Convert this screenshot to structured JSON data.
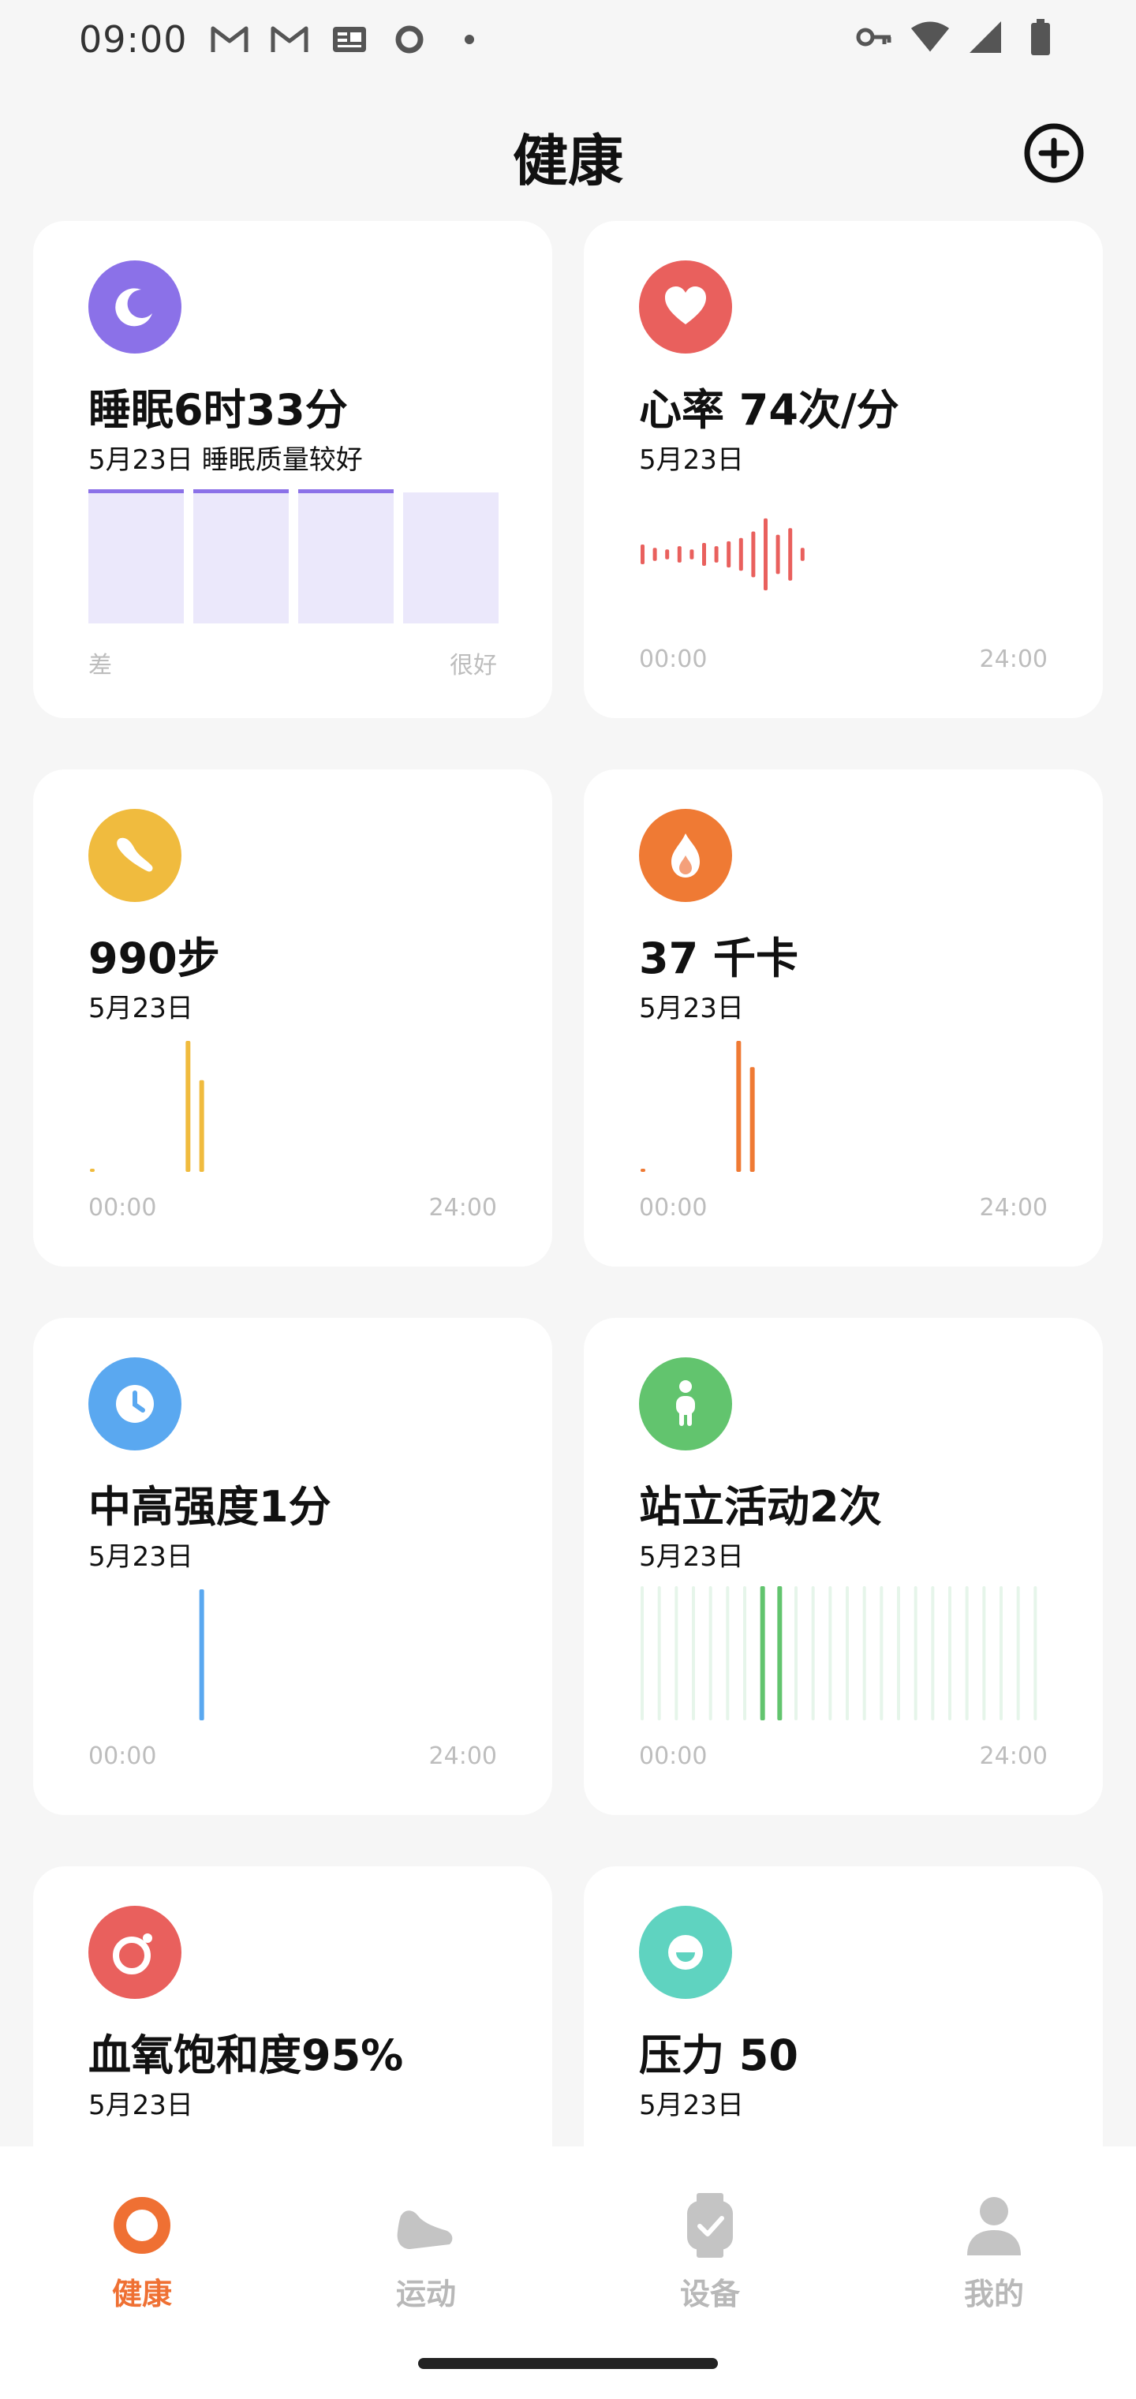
{
  "status_bar": {
    "time": "09:00",
    "left_icons": [
      "gmail-icon",
      "gmail-icon",
      "news-icon",
      "circle-icon",
      "dot-icon"
    ],
    "right_icons": [
      "vpn-key-icon",
      "wifi-icon",
      "signal-icon",
      "battery-icon"
    ]
  },
  "header": {
    "title": "健康",
    "add_icon": "add-circle-icon"
  },
  "colors": {
    "sleep": "#8b71e8",
    "heart": "#e9605d",
    "steps": "#f0bb3e",
    "calories": "#ef7a34",
    "intensity": "#5aa8f0",
    "stand": "#62c46e",
    "spo2": "#e9605d",
    "stress": "#5fd3c0",
    "nav_active": "#ef7033",
    "nav_inactive": "#b8b8b8"
  },
  "cards": [
    {
      "id": "sleep",
      "icon": "moon-icon",
      "metric": "睡眠6时33分",
      "sub": "5月23日 睡眠质量较好",
      "axis_left": "差",
      "axis_right": "很好",
      "sleep_quality_levels": 4,
      "sleep_quality_reached": 3
    },
    {
      "id": "heart",
      "icon": "heart-icon",
      "metric": "心率 74次/分",
      "sub": "5月23日",
      "axis_left": "00:00",
      "axis_right": "24:00",
      "chart_data": {
        "type": "bar",
        "x_start": "00:00",
        "x_end": "24:00",
        "values": [
          6,
          4,
          3,
          5,
          3,
          7,
          5,
          8,
          10,
          14,
          22,
          12,
          16,
          4
        ]
      }
    },
    {
      "id": "steps",
      "icon": "shoe-icon",
      "metric": "990步",
      "sub": "5月23日",
      "axis_left": "00:00",
      "axis_right": "24:00",
      "chart_data": {
        "type": "bar",
        "x_start": "00:00",
        "x_end": "24:00",
        "values": [
          1,
          0,
          0,
          0,
          0,
          0,
          0,
          100,
          70
        ]
      }
    },
    {
      "id": "calories",
      "icon": "flame-icon",
      "metric": "37 千卡",
      "sub": "5月23日",
      "axis_left": "00:00",
      "axis_right": "24:00",
      "chart_data": {
        "type": "bar",
        "x_start": "00:00",
        "x_end": "24:00",
        "values": [
          1,
          0,
          0,
          0,
          0,
          0,
          0,
          100,
          80
        ]
      }
    },
    {
      "id": "intensity",
      "icon": "clock-icon",
      "metric": "中高强度1分",
      "sub": "5月23日",
      "axis_left": "00:00",
      "axis_right": "24:00",
      "chart_data": {
        "type": "bar",
        "x_start": "00:00",
        "x_end": "24:00",
        "values": [
          0,
          0,
          0,
          0,
          0,
          0,
          0,
          0,
          100
        ]
      }
    },
    {
      "id": "stand",
      "icon": "person-icon",
      "metric": "站立活动2次",
      "sub": "5月23日",
      "axis_left": "00:00",
      "axis_right": "24:00",
      "chart_data": {
        "type": "bar",
        "x_start": "00:00",
        "x_end": "24:00",
        "slots": 24,
        "active_slots": [
          7,
          8
        ]
      }
    },
    {
      "id": "spo2",
      "icon": "spo2-icon",
      "metric": "血氧饱和度95%",
      "sub": "5月23日"
    },
    {
      "id": "stress",
      "icon": "smile-icon",
      "metric": "压力 50",
      "sub": "5月23日"
    }
  ],
  "bottom_nav": {
    "items": [
      {
        "label": "健康",
        "icon": "health-ring-icon",
        "active": true
      },
      {
        "label": "运动",
        "icon": "sneaker-icon",
        "active": false
      },
      {
        "label": "设备",
        "icon": "watch-icon",
        "active": false
      },
      {
        "label": "我的",
        "icon": "profile-icon",
        "active": false
      }
    ]
  }
}
